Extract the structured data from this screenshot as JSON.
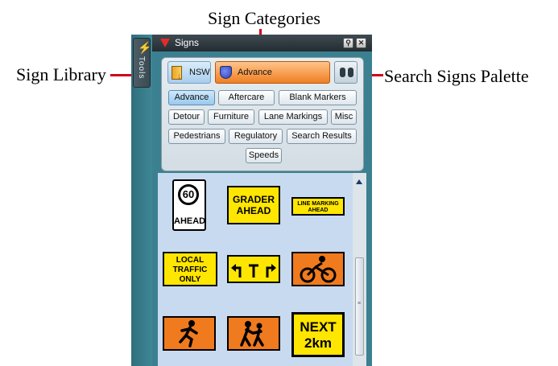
{
  "callouts": {
    "sign_categories": "Sign Categories",
    "sign_library": "Sign Library",
    "search_signs_palette": "Search Signs Palette"
  },
  "tools_tab": {
    "label": "Tools",
    "icon": "lightning-icon"
  },
  "panel": {
    "title": "Signs",
    "title_icon": "red-triangle-icon",
    "pin_glyph": "⚲",
    "close_glyph": "✕"
  },
  "toolbar": {
    "library_label": "NSW",
    "category_label": "Advance",
    "search_icon": "binoculars-icon"
  },
  "categories": [
    "Advance",
    "Aftercare",
    "Blank Markers",
    "Detour",
    "Furniture",
    "Lane Markings",
    "Misc",
    "Pedestrians",
    "Regulatory",
    "Search Results",
    "Speeds"
  ],
  "active_category": "Advance",
  "signs": {
    "s60_number": "60",
    "s60_text": "AHEAD",
    "grader": "GRADER AHEAD",
    "line_marking": "LINE MARKING AHEAD",
    "local_traffic": "LOCAL TRAFFIC ONLY",
    "turns_icon": "turn-arrows-icon",
    "cyclist_icon": "cyclist-icon",
    "worker_icon": "worker-running-icon",
    "children_icon": "children-crossing-icon",
    "next": "NEXT 2km"
  },
  "colors": {
    "accent_orange": "#f07f22",
    "sign_yellow": "#ffe600",
    "sign_orange": "#f07a1e",
    "callout_line": "#d0021b"
  }
}
